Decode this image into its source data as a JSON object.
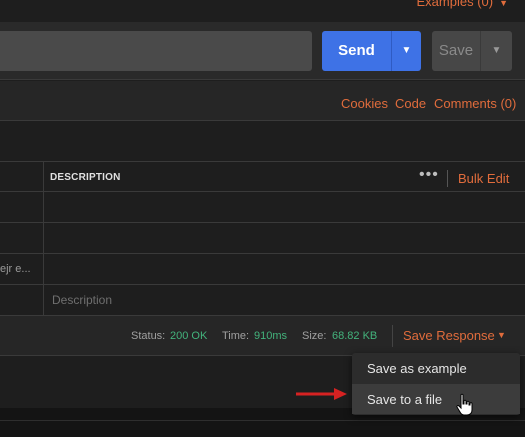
{
  "header": {
    "examples_label": "Examples (0)"
  },
  "request": {
    "send_label": "Send",
    "save_label": "Save"
  },
  "links": {
    "cookies": "Cookies",
    "code": "Code",
    "comments": "Comments (0)"
  },
  "params_table": {
    "description_header": "DESCRIPTION",
    "bulk_edit": "Bulk Edit",
    "row_truncated_text": "ejr e...",
    "description_placeholder": "Description"
  },
  "response": {
    "status_label": "Status:",
    "status_value": "200 OK",
    "time_label": "Time:",
    "time_value": "910ms",
    "size_label": "Size:",
    "size_value": "68.82 KB",
    "save_response": "Save Response"
  },
  "save_menu": {
    "items": [
      "Save as example",
      "Save to a file"
    ]
  },
  "colors": {
    "accent": "#e06c3c",
    "send_blue": "#3e72e6",
    "status_green": "#43b37c",
    "annotation_arrow": "#d62222"
  }
}
